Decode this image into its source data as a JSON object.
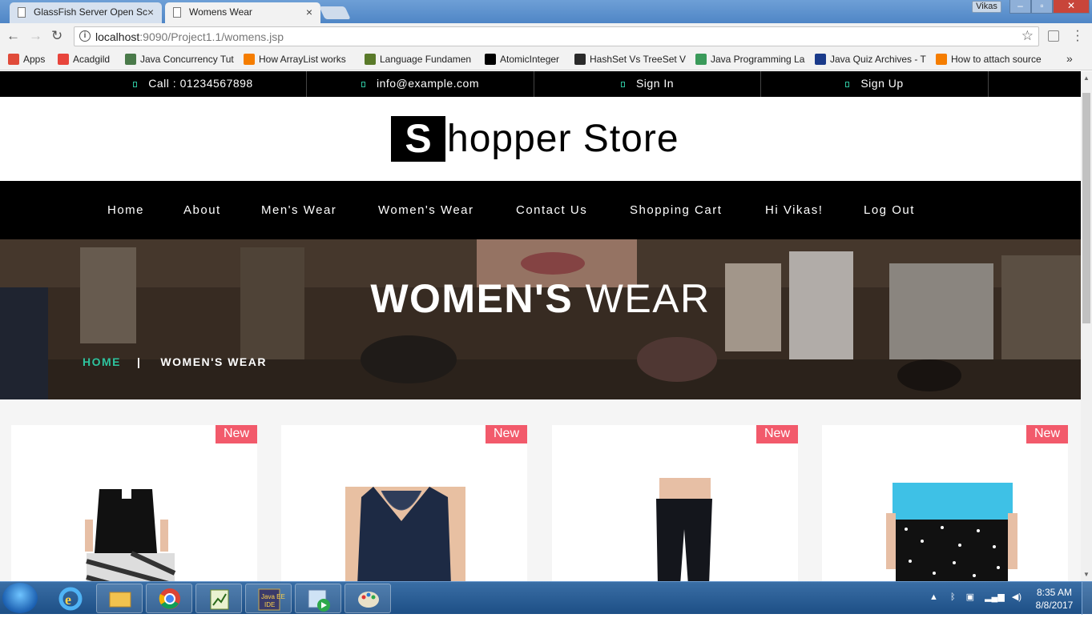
{
  "browser": {
    "tabs": [
      {
        "title": "GlassFish Server Open Sc",
        "active": false
      },
      {
        "title": "Womens Wear",
        "active": true
      }
    ],
    "window_user": "Vikas",
    "address": {
      "host": "localhost",
      "rest": ":9090/Project1.1/womens.jsp"
    },
    "bookmarks": [
      {
        "label": "Apps",
        "icon": "apps-grid-icon",
        "color": "#e04b3a"
      },
      {
        "label": "Acadgild",
        "icon": "acadgild-icon",
        "color": "#e8453c"
      },
      {
        "label": "Java Concurrency Tut",
        "icon": "diamond-icon",
        "color": "#4a7a4a"
      },
      {
        "label": "How ArrayList works",
        "icon": "blogger-icon",
        "color": "#f57d00"
      },
      {
        "label": "Language Fundamen",
        "icon": "leaf-icon",
        "color": "#5a7a2a"
      },
      {
        "label": "AtomicInteger",
        "icon": "j-icon",
        "color": "#000000"
      },
      {
        "label": "HashSet Vs TreeSet V",
        "icon": "site-icon",
        "color": "#2a2a2a"
      },
      {
        "label": "Java Programming La",
        "icon": "link-icon",
        "color": "#3a9a5a"
      },
      {
        "label": "Java Quiz Archives - T",
        "icon": "site-icon",
        "color": "#1a3a8a"
      },
      {
        "label": "How to attach source",
        "icon": "blogger-icon",
        "color": "#f57d00"
      }
    ]
  },
  "topbar": [
    {
      "label": "Call : 01234567898"
    },
    {
      "label": "info@example.com"
    },
    {
      "label": "Sign In"
    },
    {
      "label": "Sign Up"
    }
  ],
  "logo": {
    "initial": "S",
    "rest": "hopper Store"
  },
  "nav": [
    "Home",
    "About",
    "Men's Wear",
    "Women's Wear",
    "Contact Us",
    "Shopping Cart",
    "Hi Vikas!",
    "Log Out"
  ],
  "banner": {
    "title_bold": "WOMEN'S",
    "title_light": " WEAR",
    "breadcrumb_home": "HOME",
    "breadcrumb_sep": "|",
    "breadcrumb_current": "WOMEN'S WEAR"
  },
  "products": [
    {
      "badge": "New",
      "item": "black crop top"
    },
    {
      "badge": "New",
      "item": "navy lace top"
    },
    {
      "badge": "New",
      "item": "black jeans"
    },
    {
      "badge": "New",
      "item": "blue top with dotted shorts"
    }
  ],
  "taskbar": {
    "time": "8:35 AM",
    "date": "8/8/2017"
  },
  "colors": {
    "accent": "#2ec39e",
    "badge": "#f25a6b",
    "bar": "#000000"
  }
}
